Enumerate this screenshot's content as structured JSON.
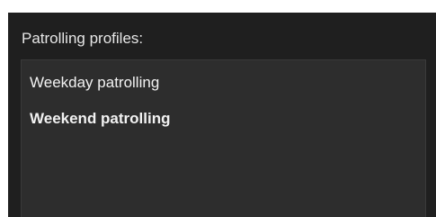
{
  "panel": {
    "label": "Patrolling profiles:"
  },
  "profiles": {
    "items": [
      {
        "label": "Weekday patrolling",
        "selected": false
      },
      {
        "label": "Weekend patrolling",
        "selected": true
      }
    ]
  },
  "colors": {
    "panel_background": "#1f1f1f",
    "list_background": "#2d2d2d",
    "text": "#f2f2f2"
  }
}
